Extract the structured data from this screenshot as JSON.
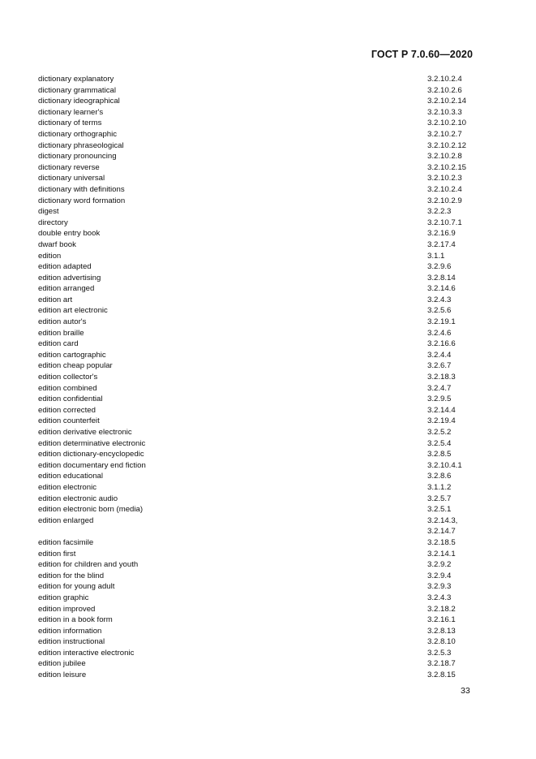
{
  "header": {
    "standard": "ГОСТ Р 7.0.60—2020"
  },
  "entries": [
    {
      "term": "dictionary explanatory",
      "ref": "3.2.10.2.4"
    },
    {
      "term": "dictionary grammatical",
      "ref": "3.2.10.2.6"
    },
    {
      "term": "dictionary ideographical",
      "ref": "3.2.10.2.14"
    },
    {
      "term": "dictionary learner's",
      "ref": "3.2.10.3.3"
    },
    {
      "term": "dictionary of terms",
      "ref": "3.2.10.2.10"
    },
    {
      "term": "dictionary orthographic",
      "ref": "3.2.10.2.7"
    },
    {
      "term": "dictionary phraseological",
      "ref": "3.2.10.2.12"
    },
    {
      "term": "dictionary pronouncing",
      "ref": "3.2.10.2.8"
    },
    {
      "term": "dictionary reverse",
      "ref": "3.2.10.2.15"
    },
    {
      "term": "dictionary universal",
      "ref": "3.2.10.2.3"
    },
    {
      "term": "dictionary with definitions",
      "ref": "3.2.10.2.4"
    },
    {
      "term": "dictionary word formation",
      "ref": "3.2.10.2.9"
    },
    {
      "term": "digest",
      "ref": "3.2.2.3"
    },
    {
      "term": "directory",
      "ref": "3.2.10.7.1"
    },
    {
      "term": "double entry book",
      "ref": "3.2.16.9"
    },
    {
      "term": "dwarf book",
      "ref": "3.2.17.4"
    },
    {
      "term": "edition",
      "ref": "3.1.1"
    },
    {
      "term": "edition adapted",
      "ref": "3.2.9.6"
    },
    {
      "term": "edition advertising",
      "ref": "3.2.8.14"
    },
    {
      "term": "edition arranged",
      "ref": "3.2.14.6"
    },
    {
      "term": "edition art",
      "ref": "3.2.4.3"
    },
    {
      "term": "edition art electronic",
      "ref": "3.2.5.6"
    },
    {
      "term": "edition autor's",
      "ref": "3.2.19.1"
    },
    {
      "term": "edition braille",
      "ref": "3.2.4.6"
    },
    {
      "term": "edition card",
      "ref": "3.2.16.6"
    },
    {
      "term": "edition cartographic",
      "ref": "3.2.4.4"
    },
    {
      "term": "edition cheap popular",
      "ref": "3.2.6.7"
    },
    {
      "term": "edition collector's",
      "ref": "3.2.18.3"
    },
    {
      "term": "edition combined",
      "ref": "3.2.4.7"
    },
    {
      "term": "edition confidential",
      "ref": "3.2.9.5"
    },
    {
      "term": "edition corrected",
      "ref": "3.2.14.4"
    },
    {
      "term": "edition counterfeit",
      "ref": "3.2.19.4"
    },
    {
      "term": "edition derivative electronic",
      "ref": "3.2.5.2"
    },
    {
      "term": "edition determinative electronic",
      "ref": "3.2.5.4"
    },
    {
      "term": "edition dictionary-encyclopedic",
      "ref": "3.2.8.5"
    },
    {
      "term": "edition documentary end fiction",
      "ref": "3.2.10.4.1"
    },
    {
      "term": "edition educational",
      "ref": "3.2.8.6"
    },
    {
      "term": "edition electronic",
      "ref": "3.1.1.2"
    },
    {
      "term": "edition electronic audio",
      "ref": "3.2.5.7"
    },
    {
      "term": "edition electronic born (media)",
      "ref": "3.2.5.1"
    },
    {
      "term": "edition enlarged",
      "ref": "3.2.14.3,\n3.2.14.7"
    },
    {
      "term": "edition facsimile",
      "ref": "3.2.18.5"
    },
    {
      "term": "edition first",
      "ref": "3.2.14.1"
    },
    {
      "term": "edition for children and youth",
      "ref": "3.2.9.2"
    },
    {
      "term": "edition for the blind",
      "ref": "3.2.9.4"
    },
    {
      "term": "edition for young adult",
      "ref": "3.2.9.3"
    },
    {
      "term": "edition graphic",
      "ref": "3.2.4.3"
    },
    {
      "term": "edition improved",
      "ref": "3.2.18.2"
    },
    {
      "term": "edition in a book form",
      "ref": "3.2.16.1"
    },
    {
      "term": "edition information",
      "ref": "3.2.8.13"
    },
    {
      "term": "edition instructional",
      "ref": "3.2.8.10"
    },
    {
      "term": "edition interactive electronic",
      "ref": "3.2.5.3"
    },
    {
      "term": "edition jubilee",
      "ref": "3.2.18.7"
    },
    {
      "term": "edition leisure",
      "ref": "3.2.8.15"
    }
  ],
  "footer": {
    "page_number": "33"
  }
}
